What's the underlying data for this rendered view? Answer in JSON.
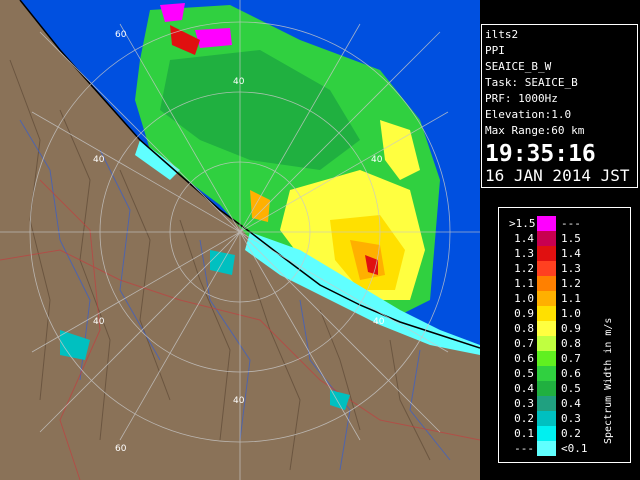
{
  "info": {
    "station": "ilts2",
    "mode": "PPI",
    "product": "SEAICE_B_W",
    "task": "Task: SEAICE_B",
    "prf": "PRF: 1000Hz",
    "elevation": "Elevation:1.0",
    "max_range": "Max Range:60 km",
    "time": "19:35:16",
    "date": "16 JAN 2014 JST"
  },
  "legend": {
    "unit_label": "Spectrum Width in m/s",
    "rows": [
      {
        "left": ">1.5",
        "right": "---",
        "color": "#ff00ff"
      },
      {
        "left": "1.4",
        "right": "1.5",
        "color": "#c80050"
      },
      {
        "left": "1.3",
        "right": "1.4",
        "color": "#e01010"
      },
      {
        "left": "1.2",
        "right": "1.3",
        "color": "#ff4020"
      },
      {
        "left": "1.1",
        "right": "1.2",
        "color": "#ff8000"
      },
      {
        "left": "1.0",
        "right": "1.1",
        "color": "#ffb000"
      },
      {
        "left": "0.9",
        "right": "1.0",
        "color": "#ffe000"
      },
      {
        "left": "0.8",
        "right": "0.9",
        "color": "#ffff40"
      },
      {
        "left": "0.7",
        "right": "0.8",
        "color": "#c0ff40"
      },
      {
        "left": "0.6",
        "right": "0.7",
        "color": "#60f020"
      },
      {
        "left": "0.5",
        "right": "0.6",
        "color": "#30d040"
      },
      {
        "left": "0.4",
        "right": "0.5",
        "color": "#20b040"
      },
      {
        "left": "0.3",
        "right": "0.4",
        "color": "#20a080"
      },
      {
        "left": "0.2",
        "right": "0.3",
        "color": "#00c0c0"
      },
      {
        "left": "0.1",
        "right": "0.2",
        "color": "#00f0f0"
      },
      {
        "left": "---",
        "right": "<0.1",
        "color": "#60ffff"
      }
    ]
  },
  "map": {
    "range_ring_labels": [
      "60",
      "40",
      "40",
      "40",
      "40",
      "40",
      "60"
    ],
    "colors": {
      "sea": "#0050e0",
      "land": "#8a7258",
      "rings": "#c8c8c8",
      "coast": "#000000"
    }
  }
}
